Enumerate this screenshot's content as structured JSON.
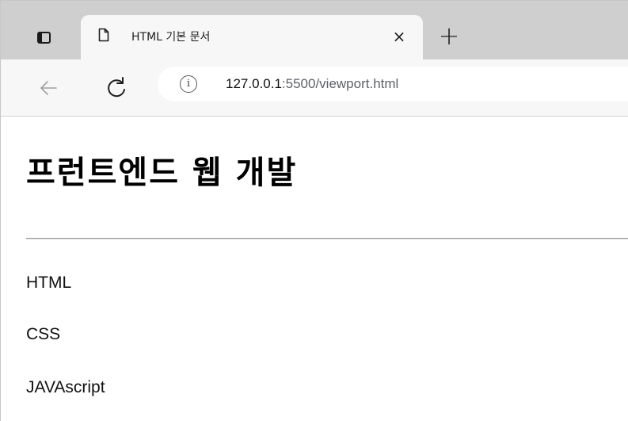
{
  "tab": {
    "title": "HTML 기본 문서",
    "close_label": "×"
  },
  "new_tab_label": "+",
  "address": {
    "host": "127.0.0.1",
    "rest": ":5500/viewport.html",
    "info_icon": "i"
  },
  "page": {
    "heading": "프런트엔드 웹 개발",
    "items": [
      "HTML",
      "CSS",
      "JAVAscript"
    ]
  }
}
